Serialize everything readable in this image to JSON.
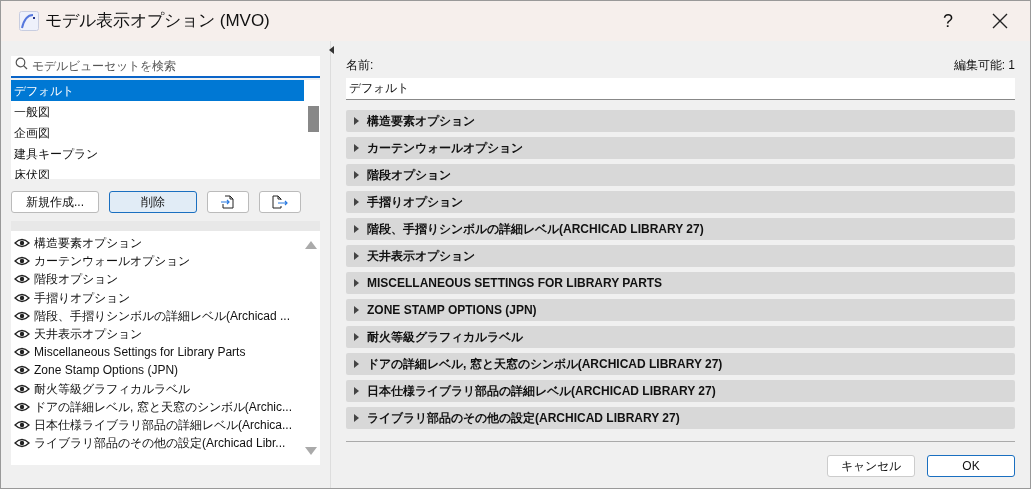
{
  "window": {
    "title": "モデル表示オプション (MVO)",
    "help": "?"
  },
  "search": {
    "placeholder": "モデルビューセットを検索"
  },
  "presets": [
    {
      "label": "デフォルト",
      "selected": true
    },
    {
      "label": "一般図",
      "selected": false
    },
    {
      "label": "企画図",
      "selected": false
    },
    {
      "label": "建具キープラン",
      "selected": false
    },
    {
      "label": "床伏図",
      "selected": false
    }
  ],
  "preset_buttons": {
    "new": "新規作成...",
    "delete": "削除"
  },
  "option_list": [
    "構造要素オプション",
    "カーテンウォールオプション",
    "階段オプション",
    "手摺りオプション",
    "階段、手摺りシンボルの詳細レベル(Archicad ...",
    "天井表示オプション",
    "Miscellaneous Settings for Library Parts",
    "Zone Stamp Options (JPN)",
    "耐火等級グラフィカルラベル",
    "ドアの詳細レベル, 窓と天窓のシンボル(Archic...",
    "日本仕様ライブラリ部品の詳細レベル(Archica...",
    "ライブラリ部品のその他の設定(Archicad Libr..."
  ],
  "name_label": "名前:",
  "editable": "編集可能: 1",
  "name_value": "デフォルト",
  "sections": [
    {
      "label": "構造要素オプション",
      "expanded": false
    },
    {
      "label": "カーテンウォールオプション",
      "expanded": false
    },
    {
      "label": "階段オプション",
      "expanded": false
    },
    {
      "label": "手摺りオプション",
      "expanded": false
    },
    {
      "label": "階段、手摺りシンボルの詳細レベル(ARCHICAD LIBRARY 27)",
      "expanded": false
    },
    {
      "label": "天井表示オプション",
      "expanded": false
    },
    {
      "label": "MISCELLANEOUS SETTINGS FOR LIBRARY PARTS",
      "expanded": false
    },
    {
      "label": "ZONE STAMP OPTIONS (JPN)",
      "expanded": false
    },
    {
      "label": "耐火等級グラフィカルラベル",
      "expanded": false
    },
    {
      "label": "ドアの詳細レベル, 窓と天窓のシンボル(ARCHICAD LIBRARY 27)",
      "expanded": false
    },
    {
      "label": "日本仕様ライブラリ部品の詳細レベル(ARCHICAD LIBRARY 27)",
      "expanded": false
    },
    {
      "label": "ライブラリ部品のその他の設定(ARCHICAD LIBRARY 27)",
      "expanded": false
    }
  ],
  "footer_buttons": {
    "cancel": "キャンセル",
    "ok": "OK"
  }
}
